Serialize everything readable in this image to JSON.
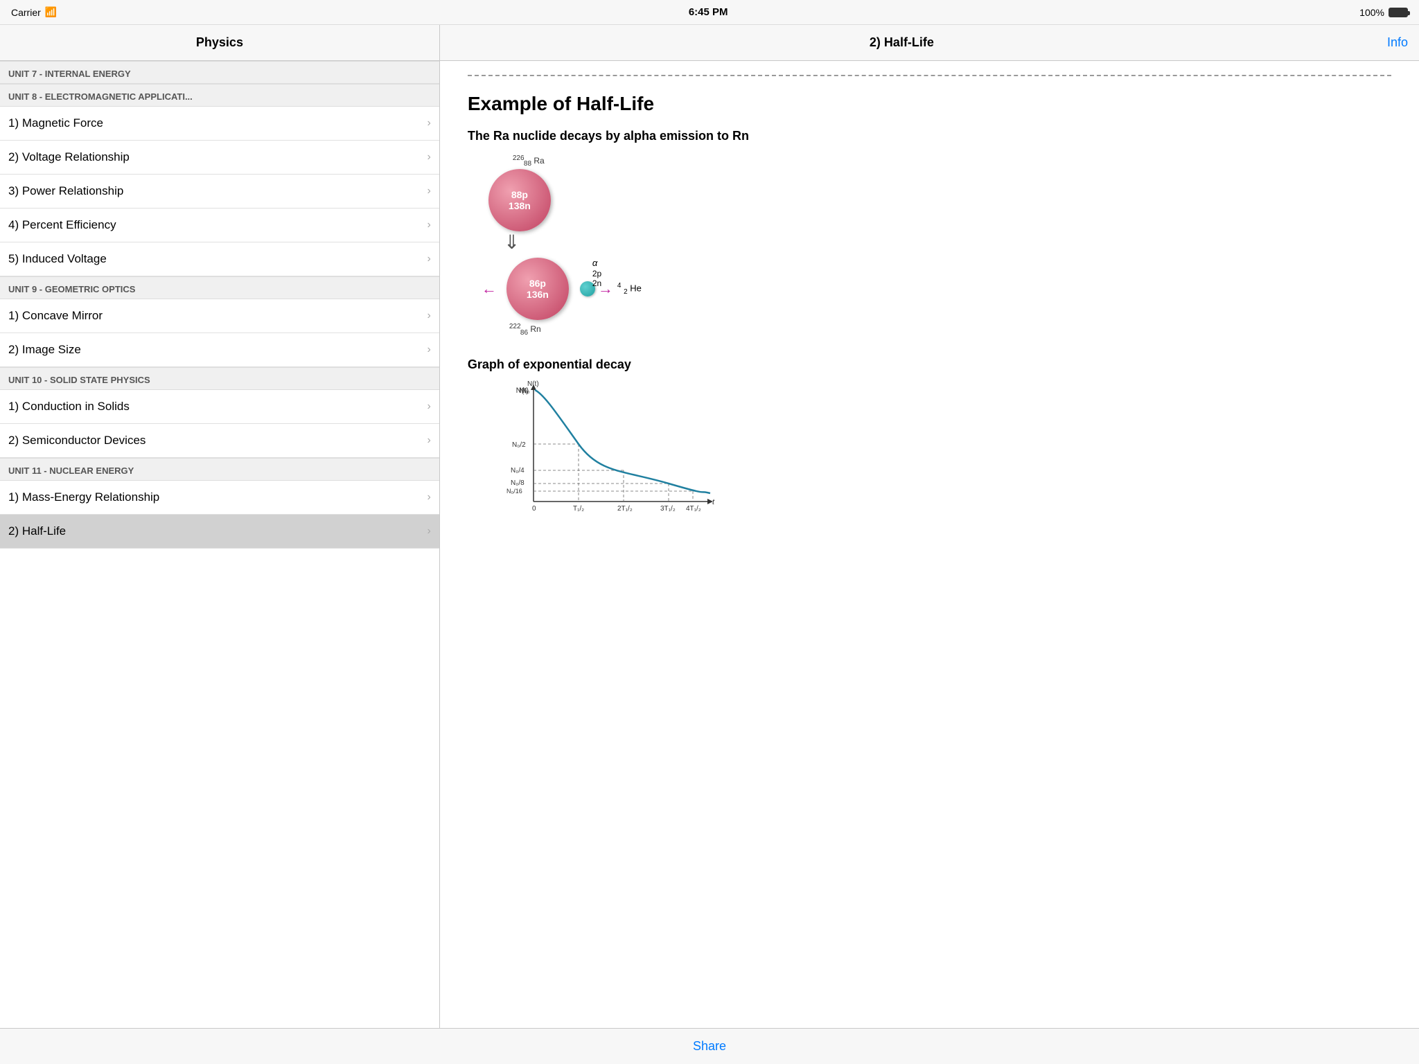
{
  "statusBar": {
    "carrier": "Carrier",
    "wifi": "wifi",
    "time": "6:45 PM",
    "battery": "100%"
  },
  "navBar": {
    "sidebarTitle": "Physics",
    "contentTitle": "2) Half-Life",
    "infoLabel": "Info"
  },
  "sidebar": {
    "unit7Header": "UNIT 7 - INTERNAL ENERGY",
    "unit8Header": "UNIT 8 - ELECTROMAGNETIC APPLICATI...",
    "unit8Items": [
      {
        "label": "1) Magnetic Force",
        "active": false
      },
      {
        "label": "2) Voltage Relationship",
        "active": false
      },
      {
        "label": "3) Power Relationship",
        "active": false
      },
      {
        "label": "4) Percent Efficiency",
        "active": false
      },
      {
        "label": "5) Induced Voltage",
        "active": false
      }
    ],
    "unit9Header": "UNIT 9 - GEOMETRIC OPTICS",
    "unit9Items": [
      {
        "label": "1) Concave Mirror",
        "active": false
      },
      {
        "label": "2) Image Size",
        "active": false
      }
    ],
    "unit10Header": "UNIT 10 - SOLID STATE PHYSICS",
    "unit10Items": [
      {
        "label": "1) Conduction in Solids",
        "active": false
      },
      {
        "label": "2) Semiconductor Devices",
        "active": false
      }
    ],
    "unit11Header": "UNIT 11 - NUCLEAR ENERGY",
    "unit11Items": [
      {
        "label": "1) Mass-Energy Relationship",
        "active": false
      },
      {
        "label": "2) Half-Life",
        "active": true
      }
    ]
  },
  "content": {
    "pageTitle": "Example of Half-Life",
    "sectionHeading1": "The Ra nuclide decays by alpha emission to Rn",
    "raLabel": "226",
    "raSubLabel": "88",
    "raSymbol": "Ra",
    "atomText1": "88p",
    "atomText2": "138n",
    "alphaLabel": "α",
    "alpha2p": "2p",
    "alpha2n": "2n",
    "atom2Text1": "86p",
    "atom2Text2": "136n",
    "heLabel": "4",
    "heSub": "2",
    "heSymbol": "He",
    "rnLabel": "222",
    "rnSub": "86",
    "rnSymbol": "Rn",
    "sectionHeading2": "Graph of exponential decay",
    "shareLabel": "Share"
  }
}
